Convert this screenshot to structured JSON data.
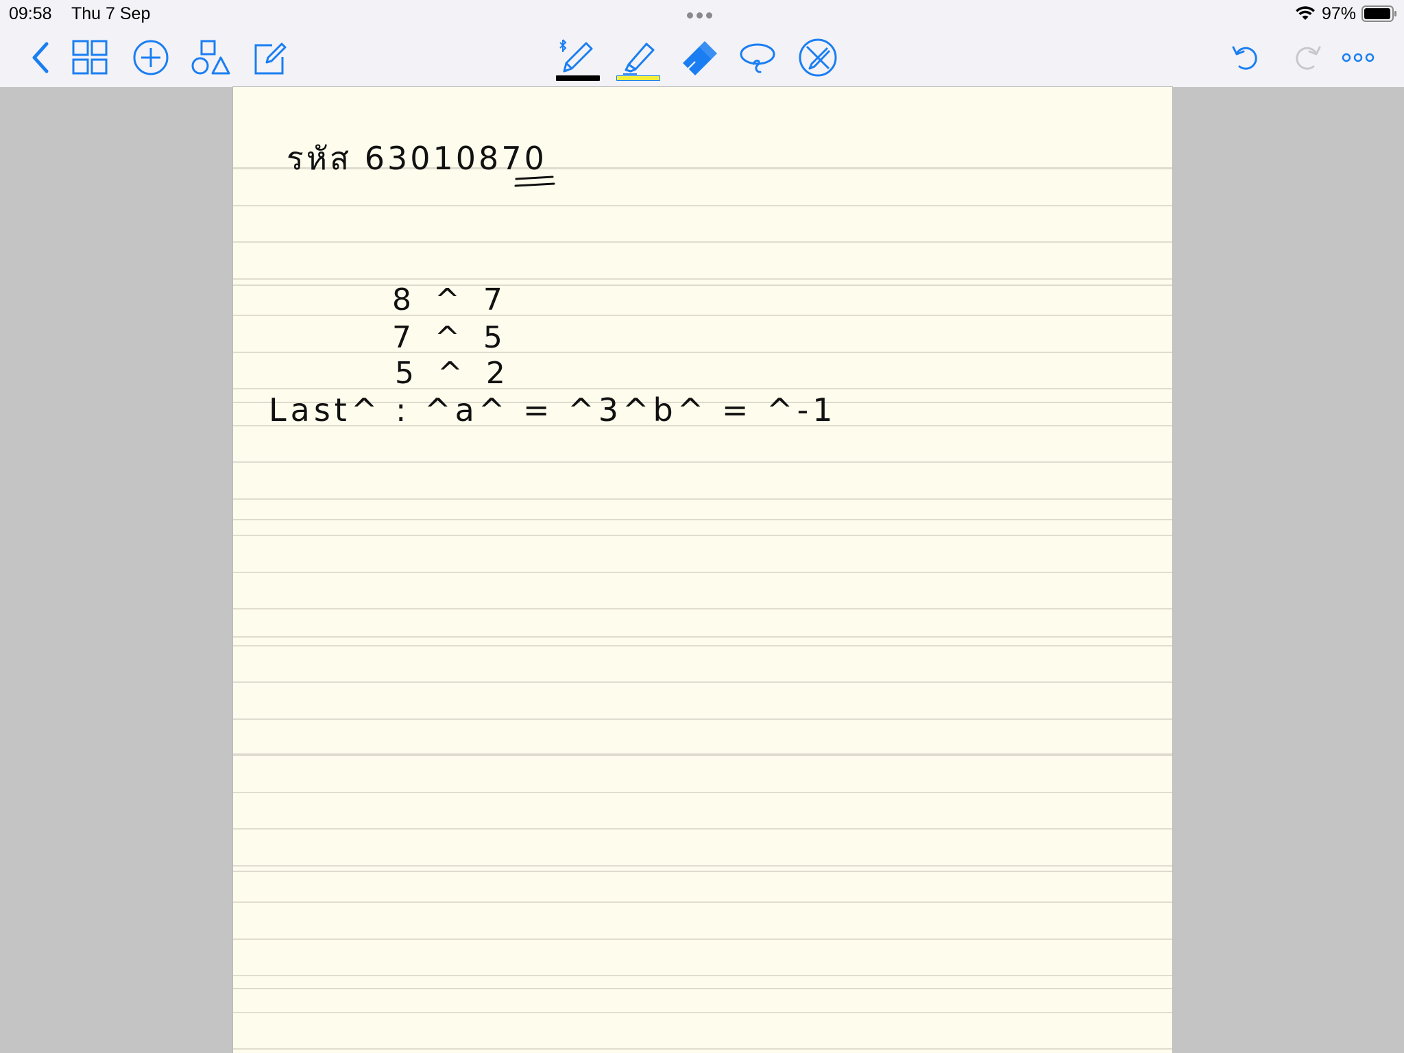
{
  "status_bar": {
    "time": "09:58",
    "date": "Thu 7 Sep",
    "battery_percent": "97%"
  },
  "toolbar": {
    "left_tools": [
      "back-icon",
      "thumbnails-icon",
      "add-icon",
      "shapes-icon",
      "edit-icon"
    ],
    "drawing_tools": [
      {
        "name": "pen-tool",
        "color": "#000000",
        "selected": true
      },
      {
        "name": "highlighter-tool",
        "color": "#f3ef3b"
      },
      {
        "name": "eraser-tool"
      },
      {
        "name": "lasso-tool"
      },
      {
        "name": "laser-tool"
      }
    ],
    "right_tools": [
      "undo-icon",
      "redo-icon",
      "more-icon"
    ],
    "accent_color": "#1a7ef2"
  },
  "note": {
    "paper_color": "#fefcec",
    "lines": [
      "รหัส 63010870",
      "8 ^ 7",
      "7 ^ 5",
      "5 ^ 2",
      "Last^ : ^a^ = ^3^b^ = ^-1"
    ]
  }
}
